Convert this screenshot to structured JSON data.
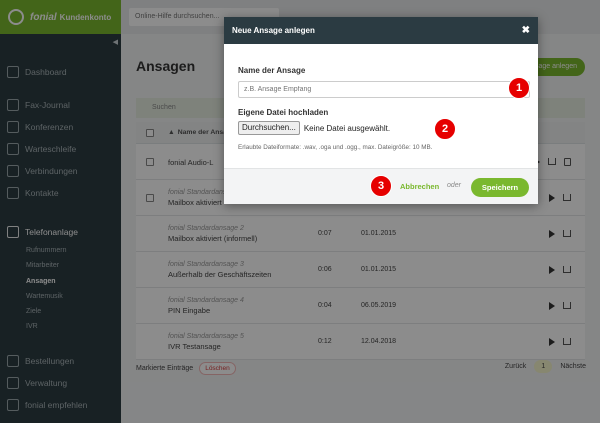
{
  "brand": {
    "name": "fonial",
    "product": "Kundenkonto"
  },
  "topbar": {
    "help_search": "Online-Hilfe durchsuchen..."
  },
  "sidebar": {
    "items": [
      {
        "label": "Dashboard",
        "icon": "dashboard-icon"
      },
      {
        "label": "Fax-Journal",
        "icon": "fax-icon"
      },
      {
        "label": "Konferenzen",
        "icon": "conference-icon"
      },
      {
        "label": "Warteschleife",
        "icon": "queue-icon"
      },
      {
        "label": "Verbindungen",
        "icon": "phone-icon"
      },
      {
        "label": "Kontakte",
        "icon": "contacts-icon"
      },
      {
        "label": "Telefonanlage",
        "icon": "pbx-icon"
      }
    ],
    "subitems": [
      "Rufnummern",
      "Mitarbeiter",
      "Ansagen",
      "Wartemusik",
      "Ziele",
      "IVR"
    ],
    "bottom_items": [
      {
        "label": "Bestellungen",
        "icon": "cart-icon"
      },
      {
        "label": "Verwaltung",
        "icon": "user-icon"
      },
      {
        "label": "fonial empfehlen",
        "icon": "recommend-icon"
      }
    ]
  },
  "page": {
    "title": "Ansagen",
    "add_button": "Ansage anlegen",
    "list_search": "Suchen",
    "table_header_name": "Name der Ansage",
    "rows": [
      {
        "sub": "",
        "name": "fonial Audio-L",
        "duration": "",
        "date": ""
      },
      {
        "sub": "fonial Standardansage",
        "name": "Mailbox aktiviert",
        "duration": "",
        "date": ""
      },
      {
        "sub": "fonial Standardansage 2",
        "name": "Mailbox aktiviert (informell)",
        "duration": "0:07",
        "date": "01.01.2015"
      },
      {
        "sub": "fonial Standardansage 3",
        "name": "Außerhalb der Geschäftszeiten",
        "duration": "0:06",
        "date": "01.01.2015"
      },
      {
        "sub": "fonial Standardansage 4",
        "name": "PIN Eingabe",
        "duration": "0:04",
        "date": "06.05.2019"
      },
      {
        "sub": "fonial Standardansage 5",
        "name": "IVR Testansage",
        "duration": "0:12",
        "date": "12.04.2018"
      }
    ],
    "marked": "Markierte Einträge",
    "delete": "Löschen",
    "pager": {
      "prev": "Zurück",
      "page": "1",
      "next": "Nächste"
    }
  },
  "modal": {
    "title": "Neue Ansage anlegen",
    "close": "✖",
    "name_label": "Name der Ansage",
    "name_placeholder": "z.B. Ansage Empfang",
    "file_label": "Eigene Datei hochladen",
    "file_button": "Durchsuchen...",
    "file_status": "Keine Datei ausgewählt.",
    "hint": "Erlaubte Dateiformate: .wav, .oga und .ogg., max. Dateigröße: 10 MB.",
    "cancel": "Abbrechen",
    "or": "oder",
    "save": "Speichern"
  },
  "badges": [
    "1",
    "2",
    "3"
  ],
  "colors": {
    "accent": "#7ab82e",
    "sidebar": "#2d3d43",
    "badge": "#e60000"
  }
}
